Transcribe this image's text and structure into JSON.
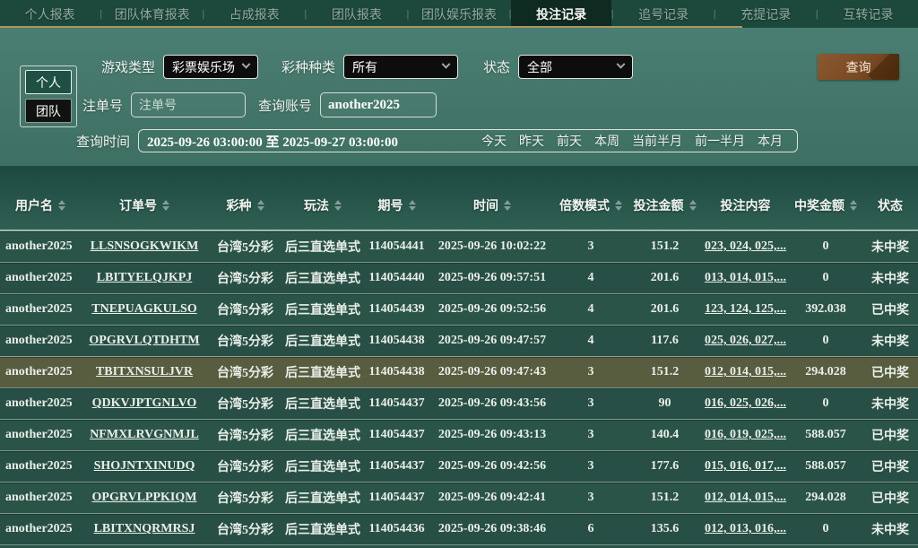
{
  "nav": {
    "tabs": [
      {
        "label": "个人报表",
        "active": false
      },
      {
        "label": "团队体育报表",
        "active": false
      },
      {
        "label": "占成报表",
        "active": false
      },
      {
        "label": "团队报表",
        "active": false
      },
      {
        "label": "团队娱乐报表",
        "active": false
      },
      {
        "label": "投注记录",
        "active": true
      },
      {
        "label": "追号记录",
        "active": false
      },
      {
        "label": "充提记录",
        "active": false
      },
      {
        "label": "互转记录",
        "active": false
      }
    ]
  },
  "filters": {
    "scope_personal": "个人",
    "scope_team": "团队",
    "game_type_label": "游戏类型",
    "game_type_value": "彩票娱乐场",
    "lottery_category_label": "彩种种类",
    "lottery_category_value": "所有",
    "status_label": "状态",
    "status_value": "全部",
    "order_no_label": "注单号",
    "order_no_placeholder": "注单号",
    "account_label": "查询账号",
    "account_value": "another2025",
    "time_label": "查询时间",
    "time_value": "2025-09-26 03:00:00 至 2025-09-27 03:00:00",
    "quick_ranges": [
      "今天",
      "昨天",
      "前天",
      "本周",
      "当前半月",
      "前一半月",
      "本月"
    ],
    "search_button": "查询"
  },
  "table": {
    "columns": [
      {
        "label": "用户名",
        "sortable": true
      },
      {
        "label": "订单号",
        "sortable": true
      },
      {
        "label": "彩种",
        "sortable": true
      },
      {
        "label": "玩法",
        "sortable": true
      },
      {
        "label": "期号",
        "sortable": true
      },
      {
        "label": "时间",
        "sortable": true
      },
      {
        "label": "倍数模式",
        "sortable": true
      },
      {
        "label": "投注金额",
        "sortable": true
      },
      {
        "label": "投注内容",
        "sortable": false
      },
      {
        "label": "中奖金额",
        "sortable": true
      },
      {
        "label": "状态",
        "sortable": false
      }
    ],
    "rows": [
      {
        "highlight": false,
        "cells": [
          "another2025",
          "LLSNSOGKWIKM",
          "台湾5分彩",
          "后三直选单式",
          "114054441",
          "2025-09-26 10:02:22",
          "3",
          "151.2",
          "023, 024, 025,...",
          "0",
          "未中奖"
        ]
      },
      {
        "highlight": false,
        "cells": [
          "another2025",
          "LBITYELQJKPJ",
          "台湾5分彩",
          "后三直选单式",
          "114054440",
          "2025-09-26 09:57:51",
          "4",
          "201.6",
          "013, 014, 015,...",
          "0",
          "未中奖"
        ]
      },
      {
        "highlight": false,
        "cells": [
          "another2025",
          "TNEPUAGKULSO",
          "台湾5分彩",
          "后三直选单式",
          "114054439",
          "2025-09-26 09:52:56",
          "4",
          "201.6",
          "123, 124, 125,...",
          "392.038",
          "已中奖"
        ]
      },
      {
        "highlight": false,
        "cells": [
          "another2025",
          "OPGRVLQTDHTM",
          "台湾5分彩",
          "后三直选单式",
          "114054438",
          "2025-09-26 09:47:57",
          "4",
          "117.6",
          "025, 026, 027,...",
          "0",
          "未中奖"
        ]
      },
      {
        "highlight": true,
        "cells": [
          "another2025",
          "TBITXNSULJVR",
          "台湾5分彩",
          "后三直选单式",
          "114054438",
          "2025-09-26 09:47:43",
          "3",
          "151.2",
          "012, 014, 015,...",
          "294.028",
          "已中奖"
        ]
      },
      {
        "highlight": false,
        "cells": [
          "another2025",
          "QDKVJPTGNLVO",
          "台湾5分彩",
          "后三直选单式",
          "114054437",
          "2025-09-26 09:43:56",
          "3",
          "90",
          "016, 025, 026,...",
          "0",
          "未中奖"
        ]
      },
      {
        "highlight": false,
        "cells": [
          "another2025",
          "NFMXLRVGNMJL",
          "台湾5分彩",
          "后三直选单式",
          "114054437",
          "2025-09-26 09:43:13",
          "3",
          "140.4",
          "016, 019, 025,...",
          "588.057",
          "已中奖"
        ]
      },
      {
        "highlight": false,
        "cells": [
          "another2025",
          "SHOJNTXINUDQ",
          "台湾5分彩",
          "后三直选单式",
          "114054437",
          "2025-09-26 09:42:56",
          "3",
          "177.6",
          "015, 016, 017,...",
          "588.057",
          "已中奖"
        ]
      },
      {
        "highlight": false,
        "cells": [
          "another2025",
          "OPGRVLPPKIQM",
          "台湾5分彩",
          "后三直选单式",
          "114054437",
          "2025-09-26 09:42:41",
          "3",
          "151.2",
          "012, 014, 015,...",
          "294.028",
          "已中奖"
        ]
      },
      {
        "highlight": false,
        "cells": [
          "another2025",
          "LBITXNQRMRSJ",
          "台湾5分彩",
          "后三直选单式",
          "114054436",
          "2025-09-26 09:38:46",
          "6",
          "135.6",
          "012, 013, 016,...",
          "0",
          "未中奖"
        ]
      }
    ]
  },
  "colors": {
    "accent_gold": "#ab9660",
    "nav_bg": "#1d483c",
    "nav_active_bg": "#0f2b21",
    "panel_teal": "#47796d",
    "table_green": "#2b5449",
    "highlight_row_olive": "#585d40",
    "search_button_brown": "#7a4a24",
    "select_black": "#0c0d0c"
  }
}
